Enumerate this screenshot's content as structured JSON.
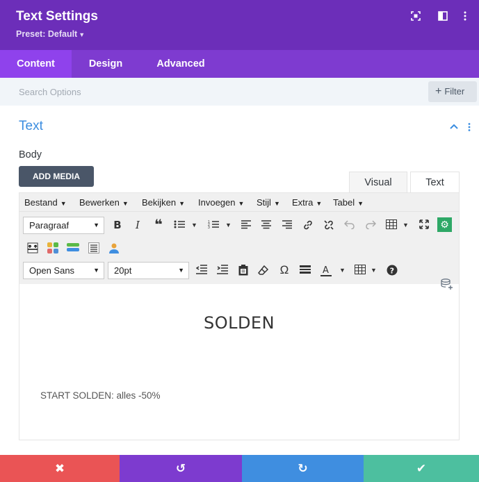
{
  "header": {
    "title": "Text Settings",
    "preset": "Preset: Default",
    "icons": [
      "expand-icon",
      "sidebar-icon",
      "more-vertical-icon"
    ]
  },
  "tabs": [
    {
      "label": "Content",
      "active": true
    },
    {
      "label": "Design",
      "active": false
    },
    {
      "label": "Advanced",
      "active": false
    }
  ],
  "search": {
    "placeholder": "Search Options",
    "value": "",
    "filter_label": "Filter"
  },
  "section": {
    "title": "Text",
    "expanded": true
  },
  "body_label": "Body",
  "add_media_label": "ADD MEDIA",
  "editor_modes": [
    {
      "label": "Visual",
      "active": true
    },
    {
      "label": "Text",
      "active": false
    }
  ],
  "menubar": [
    "Bestand",
    "Bewerken",
    "Bekijken",
    "Invoegen",
    "Stijl",
    "Extra",
    "Tabel"
  ],
  "toolbar": {
    "format_select": "Paragraaf",
    "font_family_select": "Open Sans",
    "font_size_select": "20pt",
    "row1_icons": [
      "bold-icon",
      "italic-icon",
      "blockquote-icon",
      "bullet-list-icon",
      "numbered-list-icon",
      "align-left-icon",
      "align-center-icon",
      "align-right-icon",
      "link-icon",
      "unlink-icon",
      "undo-icon",
      "redo-icon",
      "table-icon",
      "fullscreen-icon",
      "settings-icon"
    ],
    "row2_icons": [
      "page-break-icon",
      "color-grid-icon",
      "button-icon",
      "list-box-icon",
      "user-icon"
    ],
    "row3_icons": [
      "outdent-icon",
      "indent-icon",
      "paste-icon",
      "eraser-icon",
      "omega-icon",
      "horizontal-rule-icon",
      "text-color-icon",
      "table-icon",
      "help-icon"
    ]
  },
  "content": {
    "heading": "SOLDEN",
    "paragraph": "START SOLDEN: alles -50%"
  },
  "footer": {
    "buttons": [
      {
        "name": "cancel",
        "color": "#ea5455"
      },
      {
        "name": "undo",
        "color": "#7d3bcf"
      },
      {
        "name": "redo",
        "color": "#3f8ee0"
      },
      {
        "name": "save",
        "color": "#4dbf9f"
      }
    ]
  },
  "colors": {
    "header_bg": "#6c2eb9",
    "tabs_bg": "#7e3bd0",
    "active_tab_bg": "#8f42ec",
    "section_title": "#3b8de0"
  }
}
